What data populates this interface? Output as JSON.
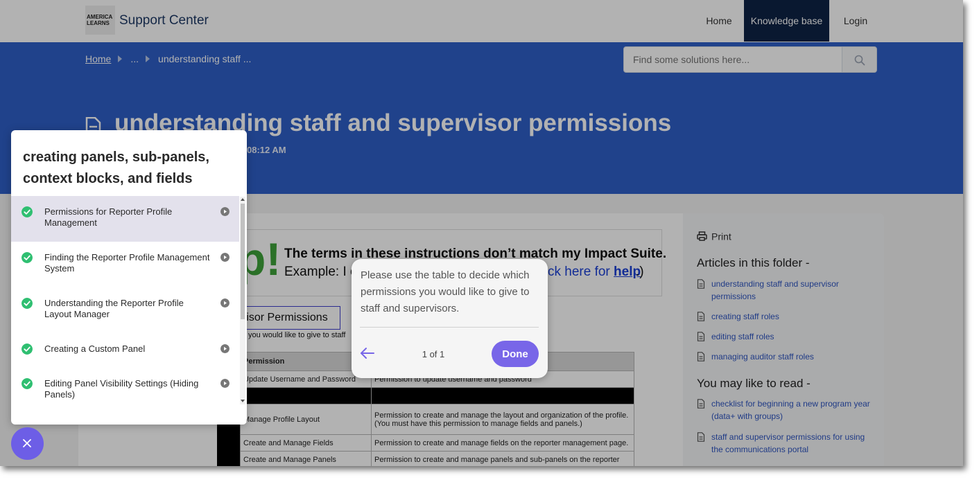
{
  "header": {
    "logo_text": "AMERICA LEARNS",
    "brand": "Support Center",
    "nav": {
      "home": "Home",
      "knowledge_base": "Knowledge base",
      "login": "Login"
    }
  },
  "hero": {
    "breadcrumb": {
      "home": "Home",
      "ellipsis": "...",
      "current": "understanding staff ..."
    },
    "search_placeholder": "Find some solutions here...",
    "title": "understanding staff and supervisor permissions",
    "timestamp": "08:12 AM"
  },
  "article": {
    "help_title": "The terms in these instructions don’t match my Impact Suite.",
    "help_example": "Example: I c",
    "help_link_prefix": "ck here for ",
    "help_link_bold": "help",
    "help_suffix": ".)",
    "section_box": "rvisor Permissions",
    "section_sub": "you would like to give to staff",
    "table": {
      "header": "Permission",
      "rows": [
        {
          "name": "Update Username and Password",
          "desc": "Permission to update username and password"
        },
        {
          "name": "Manage Profile Layout",
          "desc": "Permission to create and manage the layout and organization of the profile. (You must have this permission to manage fields and panels.)"
        },
        {
          "name": "Create and Manage Fields",
          "desc": "Permission to create and manage fields on the reporter management page."
        },
        {
          "name": "Create and Manage Panels",
          "desc": "Permission to create and manage panels and sub-panels on the reporter"
        }
      ]
    }
  },
  "sidebar": {
    "print": "Print",
    "folder_heading": "Articles in this folder -",
    "folder_articles": [
      "understanding staff and supervisor permissions",
      "creating staff roles",
      "editing staff roles",
      "managing auditor staff roles"
    ],
    "read_heading": "You may like to read -",
    "read_articles": [
      "checklist for beginning a new program year (data+ with groups)",
      "staff and supervisor permissions for using the communications portal"
    ]
  },
  "tooltip": {
    "text": "Please use the table to decide which permissions you would like to give to staff and supervisors.",
    "counter": "1 of 1",
    "done": "Done"
  },
  "checklist": {
    "title": "creating panels, sub-panels, context blocks, and fields",
    "items": [
      {
        "label": "Permissions for Reporter Profile Management",
        "completed": true,
        "selected": true
      },
      {
        "label": "Finding the Reporter Profile Management System",
        "completed": true,
        "selected": false
      },
      {
        "label": "Understanding the Reporter Profile Layout Manager",
        "completed": true,
        "selected": false
      },
      {
        "label": "Creating a Custom Panel",
        "completed": true,
        "selected": false
      },
      {
        "label": "Editing Panel Visibility Settings (Hiding Panels)",
        "completed": true,
        "selected": false
      }
    ]
  },
  "icons": {
    "search": "search-icon",
    "document": "document-icon",
    "printer": "printer-icon",
    "check": "check-circle-icon",
    "arrow": "chevron-right-icon",
    "back": "arrow-left-icon",
    "close": "close-icon"
  },
  "colors": {
    "hero_blue": "#2f5fc8",
    "nav_active": "#0d2345",
    "accent_purple": "#7866e8",
    "check_green": "#2fbf71",
    "link_blue": "#2f55c0"
  }
}
